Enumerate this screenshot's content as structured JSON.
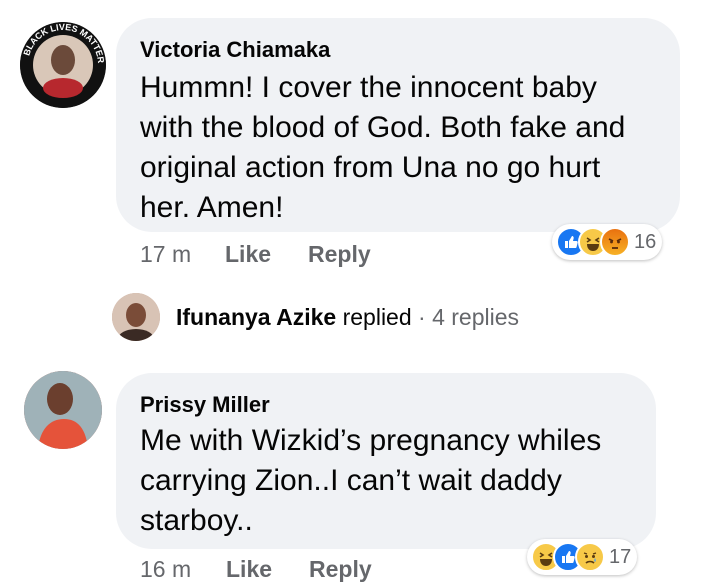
{
  "comments": [
    {
      "author": "Victoria Chiamaka",
      "lines": [
        "Hummn! I cover the innocent baby",
        "with the blood of God. Both fake and",
        "original action from Una no go hurt",
        "her. Amen!"
      ],
      "time": "17 m",
      "like_label": "Like",
      "reply_label": "Reply",
      "reaction_icons": [
        "like-icon",
        "haha-icon",
        "angry-icon"
      ],
      "reaction_count": "16",
      "avatar_badge_text": "BLACK LIVES MATTER"
    },
    {
      "author": "Prissy Miller",
      "lines": [
        "Me with Wizkid’s pregnancy whiles",
        "carrying Zion..I can’t wait daddy",
        "starboy.."
      ],
      "time": "16 m",
      "like_label": "Like",
      "reply_label": "Reply",
      "reaction_icons": [
        "haha-icon",
        "like-icon",
        "sad-icon"
      ],
      "reaction_count": "17"
    }
  ],
  "reply_thread": {
    "name": "Ifunanya Azike",
    "action": "replied",
    "separator": "·",
    "count": "4 replies"
  },
  "colors": {
    "bubble": "#f0f2f5",
    "meta_text": "#65676b",
    "like_blue": "#1877f2",
    "haha_yellow": "#f7c948",
    "angry_orange": "#e9710f"
  }
}
